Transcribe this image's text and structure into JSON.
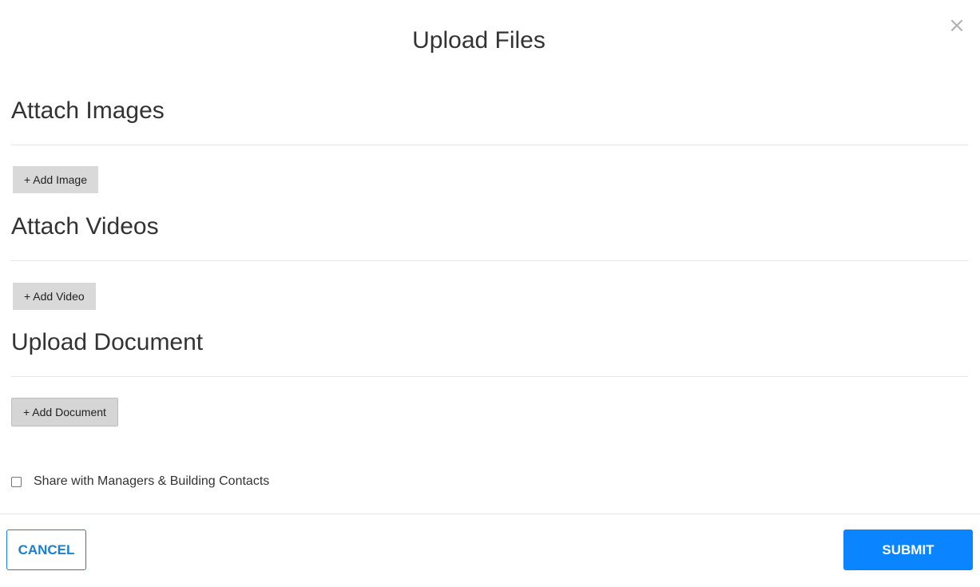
{
  "modal": {
    "title": "Upload Files",
    "close_icon": "×"
  },
  "sections": [
    {
      "heading": "Attach Images",
      "button_label": "+ Add Image"
    },
    {
      "heading": "Attach Videos",
      "button_label": "+ Add Video"
    },
    {
      "heading": "Upload Document",
      "button_label": "+ Add Document"
    }
  ],
  "share": {
    "label": "Share with Managers & Building Contacts",
    "checked": false
  },
  "footer": {
    "cancel_label": "CANCEL",
    "submit_label": "SUBMIT"
  },
  "colors": {
    "primary": "#0a84ff",
    "outline": "#1a7fd1",
    "button_gray": "#d9d9d9"
  }
}
